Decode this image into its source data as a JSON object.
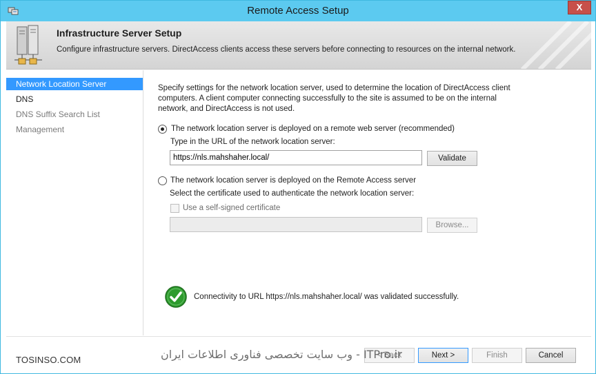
{
  "window": {
    "title": "Remote Access Setup",
    "close_glyph": "X"
  },
  "header": {
    "title": "Infrastructure Server Setup",
    "description": "Configure infrastructure servers. DirectAccess clients access these servers before connecting to resources on the internal network."
  },
  "nav": {
    "items": [
      {
        "label": "Network Location Server",
        "state": "selected"
      },
      {
        "label": "DNS",
        "state": "enabled"
      },
      {
        "label": "DNS Suffix Search List",
        "state": "disabled"
      },
      {
        "label": "Management",
        "state": "disabled"
      }
    ]
  },
  "main": {
    "intro": "Specify settings for the network location server, used to determine the location of DirectAccess client computers. A client computer connecting successfully to the site is assumed to be on the internal network, and DirectAccess is not used.",
    "option_remote": {
      "label": "The network location server is deployed on a remote web server (recommended)",
      "checked": true,
      "url_prompt": "Type in the URL of the network location server:",
      "url_value": "https://nls.mahshaher.local/",
      "validate_label": "Validate"
    },
    "option_local": {
      "label": "The network location server is deployed on the Remote Access server",
      "checked": false,
      "cert_prompt": "Select the certificate used to authenticate the network location server:",
      "self_signed_label": "Use a self-signed certificate",
      "cert_value": "",
      "browse_label": "Browse..."
    },
    "status_text": "Connectivity to URL https://nls.mahshaher.local/ was validated successfully."
  },
  "footer": {
    "back_label": "< Back",
    "next_label": "Next >",
    "finish_label": "Finish",
    "cancel_label": "Cancel"
  },
  "watermarks": {
    "left": "TOSINSO.COM",
    "right": "ITPro.ir - وب سایت تخصصی فناوری اطلاعات ایران"
  },
  "colors": {
    "titlebar": "#5ccaf0",
    "selection": "#3399ff",
    "close": "#c7504a",
    "success": "#2e9b2e"
  }
}
